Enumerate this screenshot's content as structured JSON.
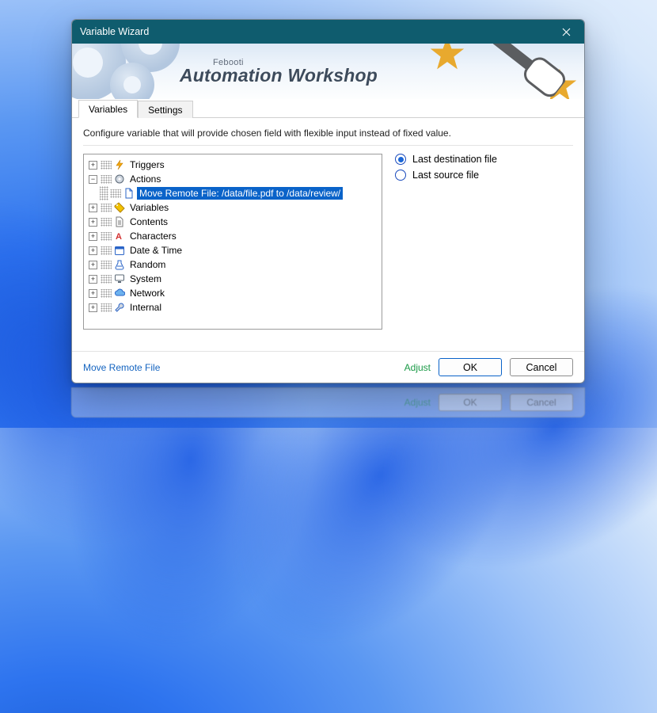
{
  "titlebar": {
    "title": "Variable Wizard"
  },
  "banner": {
    "product_sub": "Febooti",
    "product": "Automation Workshop"
  },
  "tabs": [
    {
      "label": "Variables",
      "active": true
    },
    {
      "label": "Settings",
      "active": false
    }
  ],
  "desc": "Configure variable that will provide chosen field with flexible input instead of fixed value.",
  "tree": {
    "triggers": {
      "label": "Triggers",
      "expandable": true,
      "expanded": false
    },
    "actions": {
      "label": "Actions",
      "expandable": true,
      "expanded": true,
      "child": {
        "label": "Move Remote File: /data/file.pdf to /data/review/",
        "selected": true
      }
    },
    "variables": {
      "label": "Variables",
      "expandable": true,
      "expanded": false
    },
    "contents": {
      "label": "Contents",
      "expandable": true,
      "expanded": false
    },
    "characters": {
      "label": "Characters",
      "expandable": true,
      "expanded": false
    },
    "datetime": {
      "label": "Date & Time",
      "expandable": true,
      "expanded": false
    },
    "random": {
      "label": "Random",
      "expandable": true,
      "expanded": false
    },
    "system": {
      "label": "System",
      "expandable": true,
      "expanded": false
    },
    "network": {
      "label": "Network",
      "expandable": true,
      "expanded": false
    },
    "internal": {
      "label": "Internal",
      "expandable": true,
      "expanded": false
    }
  },
  "options": [
    {
      "label": "Last destination file",
      "checked": true
    },
    {
      "label": "Last source file",
      "checked": false
    }
  ],
  "footer": {
    "context_link": "Move Remote File",
    "adjust": "Adjust",
    "ok": "OK",
    "cancel": "Cancel"
  }
}
